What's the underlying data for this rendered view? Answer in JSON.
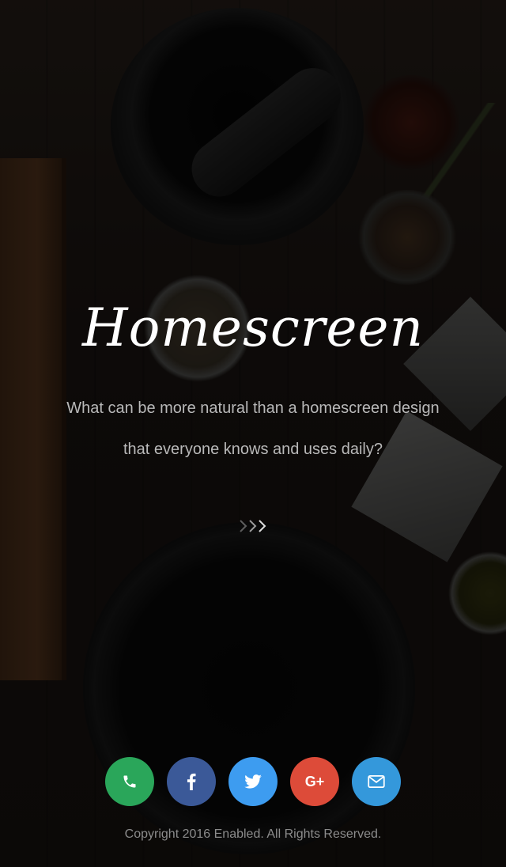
{
  "hero": {
    "title": "Homescreen",
    "subtitle": "What can be more natural than a homescreen design that everyone knows and uses daily?"
  },
  "scroll_indicator": {
    "icon": "triple-chevron-right-icon"
  },
  "social": [
    {
      "name": "phone",
      "icon": "phone-icon",
      "color": "#2aa65a"
    },
    {
      "name": "facebook",
      "icon": "facebook-icon",
      "color": "#3b5998"
    },
    {
      "name": "twitter",
      "icon": "twitter-icon",
      "color": "#3d9cf0"
    },
    {
      "name": "google-plus",
      "icon": "google-plus-icon",
      "label": "G+",
      "color": "#dd4b39"
    },
    {
      "name": "email",
      "icon": "envelope-icon",
      "color": "#3498db"
    }
  ],
  "footer": {
    "copyright": "Copyright 2016 Enabled. All Rights Reserved."
  }
}
